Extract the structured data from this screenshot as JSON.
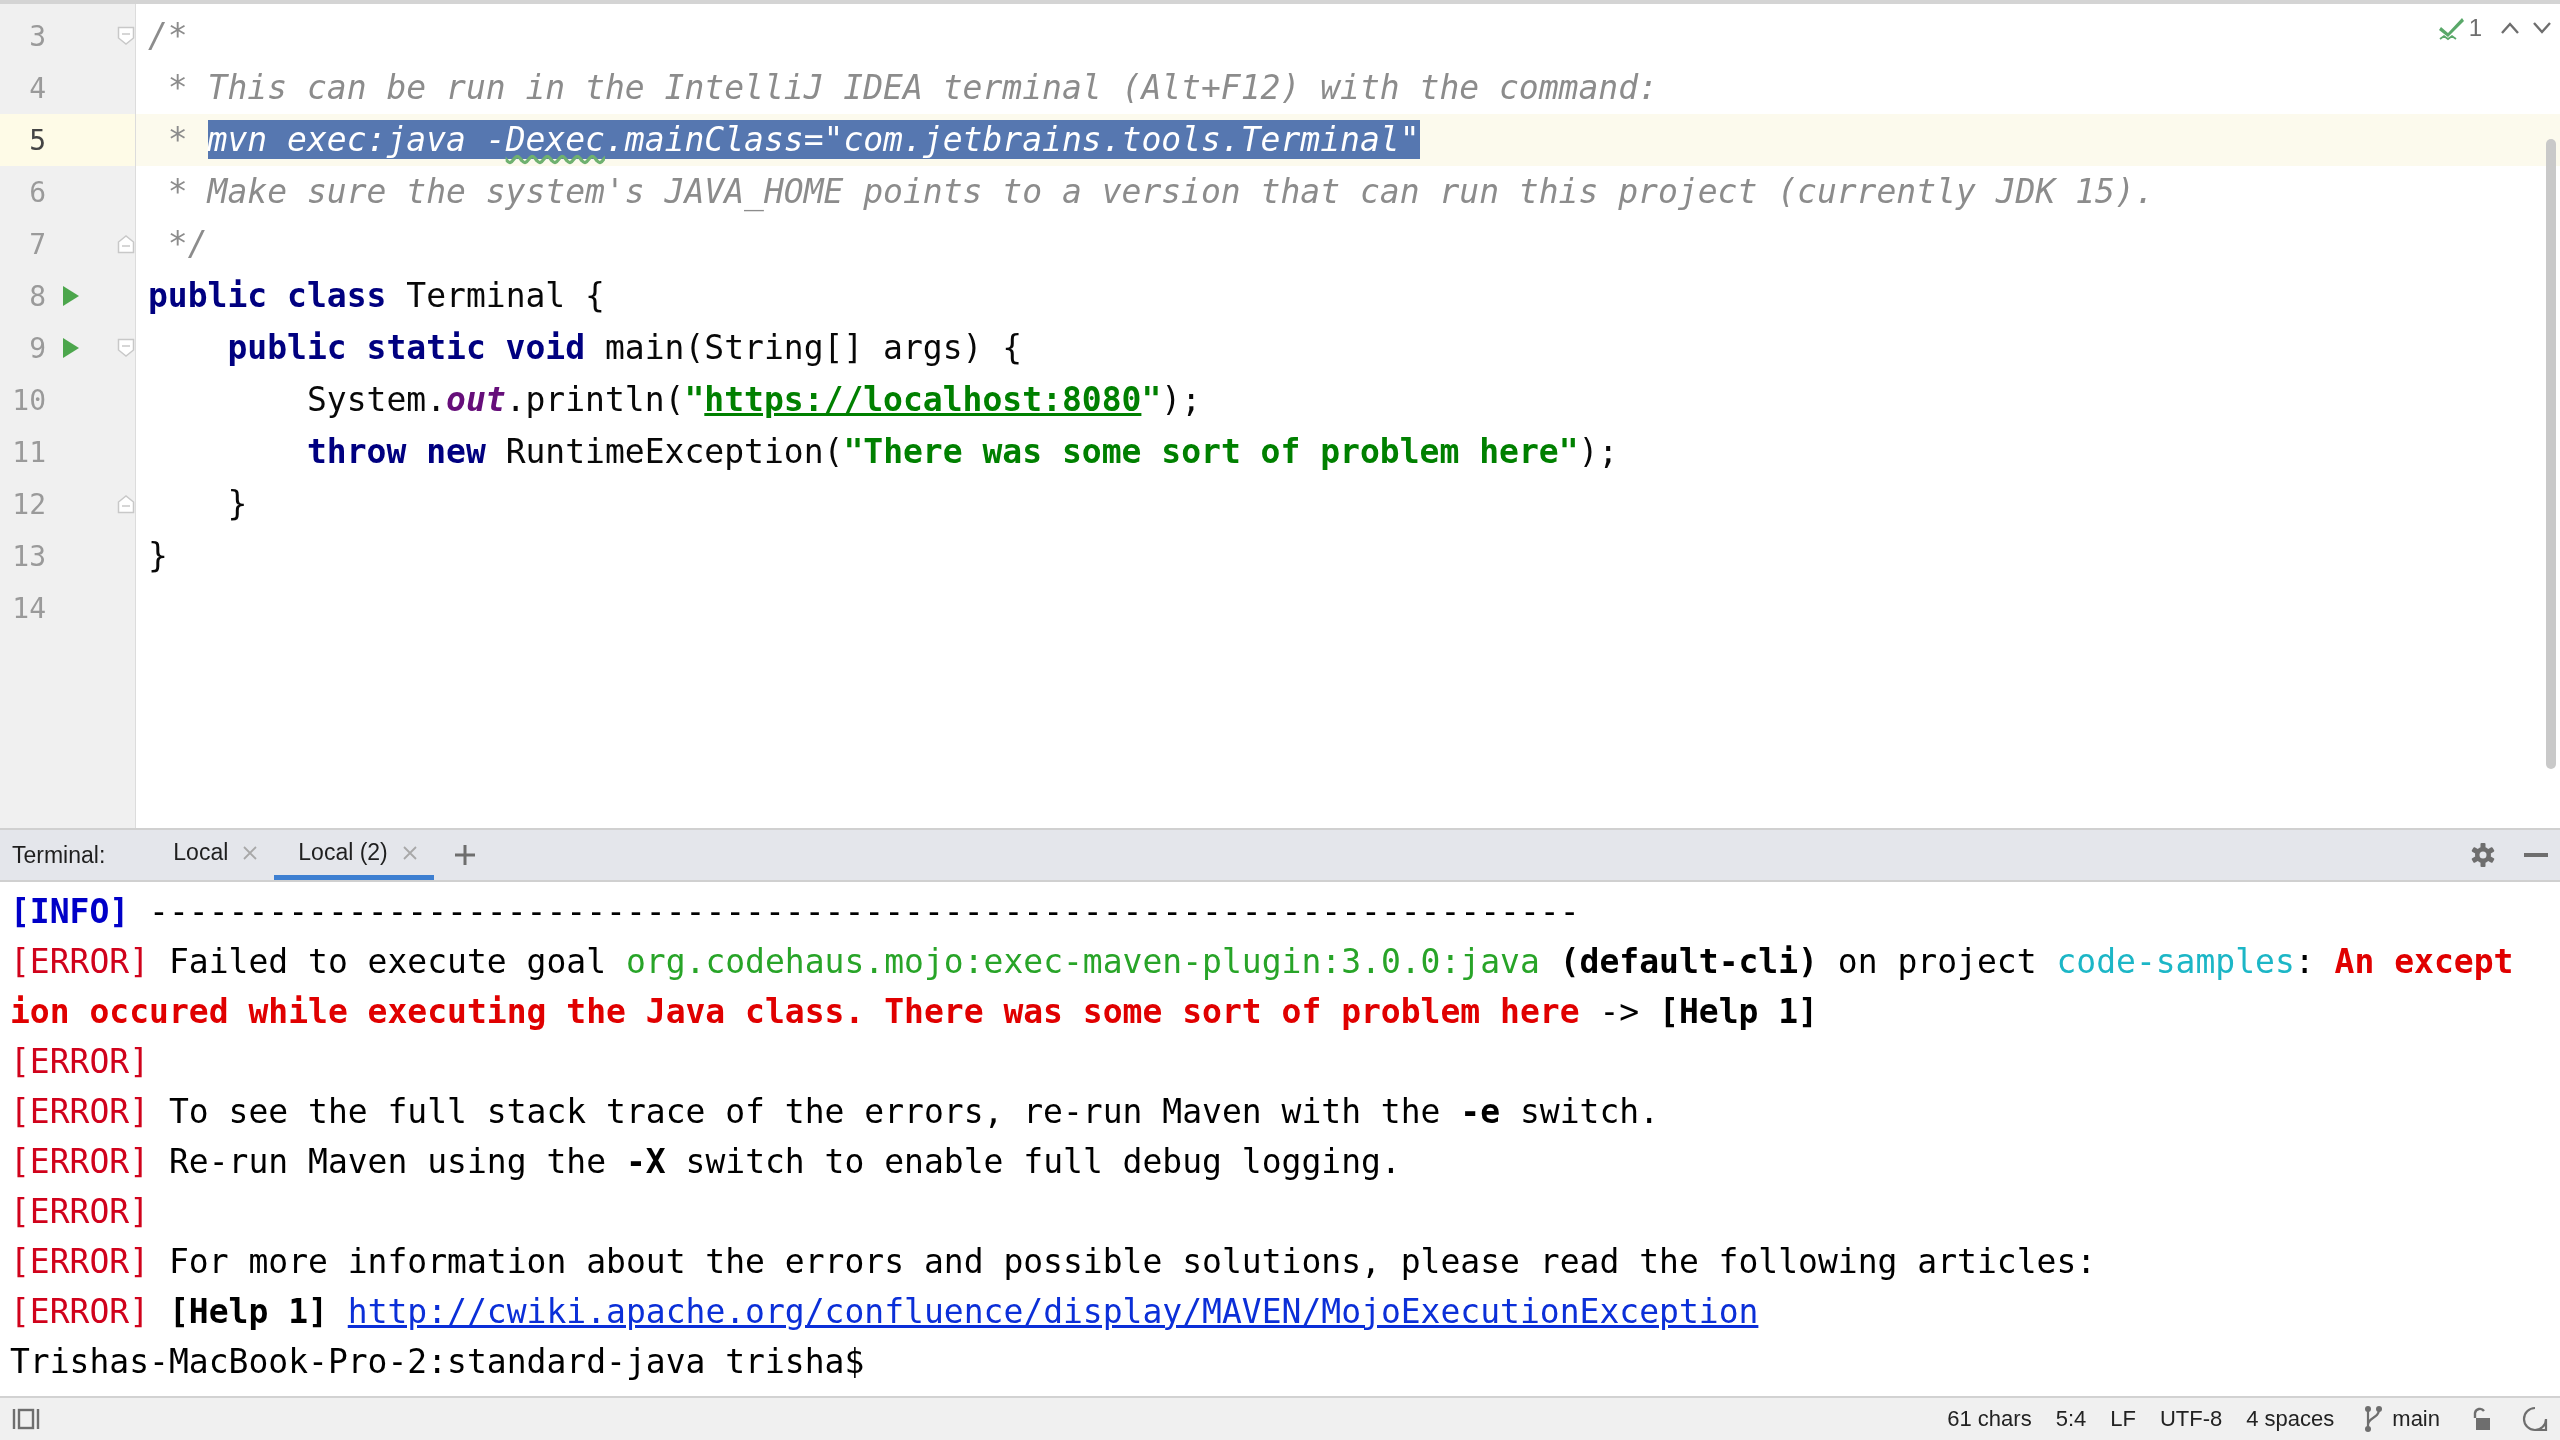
{
  "editor": {
    "inspections": {
      "count": "1"
    },
    "lines": [
      {
        "number": "3",
        "fold_start": true,
        "tokens": [
          {
            "kind": "comment",
            "text": "/*"
          }
        ]
      },
      {
        "number": "4",
        "tokens": [
          {
            "kind": "comment",
            "text": " * This can be run in the IntelliJ IDEA terminal (Alt+F12) with the command:"
          }
        ]
      },
      {
        "number": "5",
        "current": true,
        "tokens": [
          {
            "kind": "comment",
            "text": " * "
          },
          {
            "kind": "comment-selected",
            "text": "mvn exec:java -"
          },
          {
            "kind": "comment-selected-typo",
            "text": "Dexec"
          },
          {
            "kind": "comment-selected",
            "text": ".mainClass=\"com.jetbrains.tools.Terminal\""
          }
        ]
      },
      {
        "number": "6",
        "tokens": [
          {
            "kind": "comment",
            "text": " * Make sure the system's JAVA_HOME points to a version that can run this project (currently JDK 15)."
          }
        ]
      },
      {
        "number": "7",
        "fold_end": true,
        "tokens": [
          {
            "kind": "comment",
            "text": " */"
          }
        ]
      },
      {
        "number": "8",
        "run": true,
        "tokens": [
          {
            "kind": "keyword",
            "text": "public class"
          },
          {
            "kind": "plain",
            "text": " Terminal {"
          }
        ]
      },
      {
        "number": "9",
        "run": true,
        "fold_start": true,
        "tokens": [
          {
            "kind": "keyword",
            "text": "    public static void"
          },
          {
            "kind": "plain",
            "text": " main(String[] args) {"
          }
        ]
      },
      {
        "number": "10",
        "tokens": [
          {
            "kind": "plain",
            "text": "        System."
          },
          {
            "kind": "field",
            "text": "out"
          },
          {
            "kind": "plain",
            "text": ".println("
          },
          {
            "kind": "string",
            "text": "\""
          },
          {
            "kind": "string-link",
            "text": "https://localhost:8080"
          },
          {
            "kind": "string",
            "text": "\""
          },
          {
            "kind": "plain",
            "text": ");"
          }
        ]
      },
      {
        "number": "11",
        "tokens": [
          {
            "kind": "keyword",
            "text": "        throw new"
          },
          {
            "kind": "plain",
            "text": " RuntimeException("
          },
          {
            "kind": "string",
            "text": "\"There was some sort of problem here\""
          },
          {
            "kind": "plain",
            "text": ");"
          }
        ]
      },
      {
        "number": "12",
        "fold_end": true,
        "tokens": [
          {
            "kind": "plain",
            "text": "    }"
          }
        ]
      },
      {
        "number": "13",
        "tokens": [
          {
            "kind": "plain",
            "text": "}"
          }
        ]
      },
      {
        "number": "14"
      }
    ]
  },
  "terminal": {
    "label": "Terminal:",
    "tabs": [
      {
        "label": "Local",
        "selected": false
      },
      {
        "label": "Local (2)",
        "selected": true
      }
    ],
    "lines": [
      [
        {
          "kind": "info",
          "text": "[INFO]"
        },
        {
          "kind": "plain",
          "text": " ------------------------------------------------------------------------"
        }
      ],
      [
        {
          "kind": "error",
          "text": "[ERROR]"
        },
        {
          "kind": "plain",
          "text": " Failed to execute goal "
        },
        {
          "kind": "green",
          "text": "org.codehaus.mojo:exec-maven-plugin:3.0.0:java"
        },
        {
          "kind": "bold",
          "text": " (default-cli)"
        },
        {
          "kind": "plain",
          "text": " on project "
        },
        {
          "kind": "cyan",
          "text": "code-samples"
        },
        {
          "kind": "plain",
          "text": ": "
        },
        {
          "kind": "red",
          "text": "An except"
        }
      ],
      [
        {
          "kind": "red",
          "text": "ion occured while executing the Java class. There was some sort of problem here"
        },
        {
          "kind": "plain",
          "text": " -> "
        },
        {
          "kind": "bold",
          "text": "[Help 1]"
        }
      ],
      [
        {
          "kind": "error",
          "text": "[ERROR]"
        }
      ],
      [
        {
          "kind": "error",
          "text": "[ERROR]"
        },
        {
          "kind": "plain",
          "text": " To see the full stack trace of the errors, re-run Maven with the "
        },
        {
          "kind": "bold",
          "text": "-e"
        },
        {
          "kind": "plain",
          "text": " switch."
        }
      ],
      [
        {
          "kind": "error",
          "text": "[ERROR]"
        },
        {
          "kind": "plain",
          "text": " Re-run Maven using the "
        },
        {
          "kind": "bold",
          "text": "-X"
        },
        {
          "kind": "plain",
          "text": " switch to enable full debug logging."
        }
      ],
      [
        {
          "kind": "error",
          "text": "[ERROR]"
        }
      ],
      [
        {
          "kind": "error",
          "text": "[ERROR]"
        },
        {
          "kind": "plain",
          "text": " For more information about the errors and possible solutions, please read the following articles:"
        }
      ],
      [
        {
          "kind": "error",
          "text": "[ERROR]"
        },
        {
          "kind": "bold",
          "text": " [Help 1] "
        },
        {
          "kind": "link",
          "text": "http://cwiki.apache.org/confluence/display/MAVEN/MojoExecutionException"
        }
      ],
      [
        {
          "kind": "plain",
          "text": "Trishas-MacBook-Pro-2:standard-java trisha$"
        }
      ]
    ]
  },
  "status_bar": {
    "items": [
      "61 chars",
      "5:4",
      "LF",
      "UTF-8",
      "4 spaces"
    ],
    "branch": "main"
  }
}
